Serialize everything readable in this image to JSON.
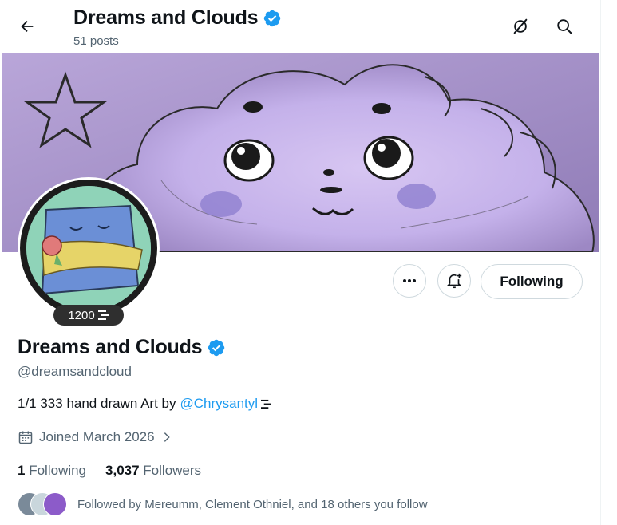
{
  "header": {
    "title": "Dreams and Clouds",
    "posts_count": "51 posts"
  },
  "profile": {
    "name": "Dreams and Clouds",
    "handle": "@dreamsandcloud",
    "avatar_badge": "1200",
    "bio_text": "1/1 333 hand drawn Art by",
    "bio_link": "@Chrysantyl",
    "joined": "Joined March 2026",
    "following_count": "1",
    "following_label": "Following",
    "followers_count": "3,037",
    "followers_label": "Followers",
    "followed_by": "Followed by Mereumm, Clement Othniel, and 18 others you follow"
  },
  "actions": {
    "following_button": "Following"
  },
  "colors": {
    "verified": "#1d9bf0",
    "link": "#1d9bf0",
    "secondary_text": "#536471",
    "banner_bg": "#c9b8e6"
  },
  "icons": [
    "back-arrow-icon",
    "verified-badge-icon",
    "grok-icon",
    "search-icon",
    "more-icon",
    "notification-bell-icon",
    "calendar-icon",
    "chevron-right-icon",
    "hamburger-badge-icon"
  ]
}
